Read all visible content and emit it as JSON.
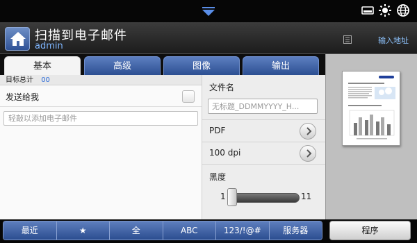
{
  "header": {
    "title": "扫描到电子邮件",
    "user": "admin",
    "input_address": "输入地址"
  },
  "tabs": [
    {
      "label": "基本",
      "active": true
    },
    {
      "label": "高级",
      "active": false
    },
    {
      "label": "图像",
      "active": false
    },
    {
      "label": "输出",
      "active": false
    }
  ],
  "recipients": {
    "total_label": "目标总计",
    "total_count": "00"
  },
  "send_to_me": {
    "label": "发送给我",
    "checked": false
  },
  "email_input": {
    "placeholder": "轻敲以添加电子邮件"
  },
  "filename": {
    "label": "文件名",
    "value": "无标题_DDMMYYYY_H..."
  },
  "options": {
    "format": "PDF",
    "resolution": "100 dpi"
  },
  "darkness": {
    "label": "黑度",
    "min": "1",
    "max": "11",
    "value": 1
  },
  "bottom_buttons": [
    "最近",
    "★",
    "全",
    "ABC",
    "123/!@#",
    "服务器"
  ],
  "program_label": "程序",
  "colors": {
    "accent_blue": "#2c4f92",
    "link_blue": "#7fb6ff",
    "count_blue": "#2a6ad8"
  }
}
